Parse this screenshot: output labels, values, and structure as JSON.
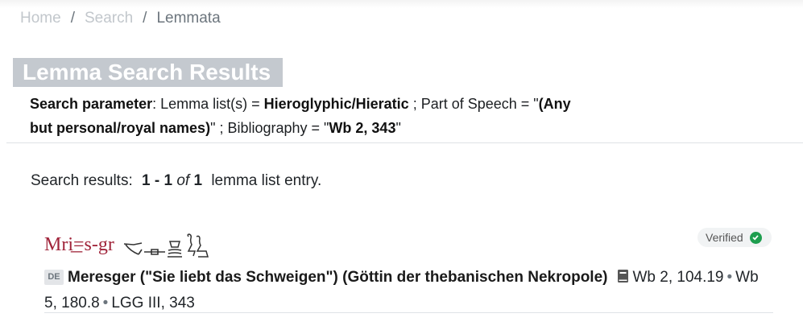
{
  "breadcrumb": {
    "home": "Home",
    "search": "Search",
    "current": "Lemmata",
    "separator": "/"
  },
  "page_title": "Lemma Search Results",
  "search_params": {
    "label": "Search parameter",
    "lemma_list_prefix": ": Lemma list(s) = ",
    "lemma_list_value": "Hieroglyphic/Hieratic",
    "pos_prefix": " ; Part of Speech = \"",
    "pos_value": "(Any but personal/royal names)",
    "bib_prefix": "\" ; Bibliography = \"",
    "bib_value": "Wb 2, 343",
    "suffix": "\""
  },
  "results": {
    "prefix": "Search results:",
    "range": "1 - 1",
    "of": "of",
    "total": "1",
    "suffix": "lemma list entry."
  },
  "entry": {
    "transliteration": "Mri͟=s-gr",
    "status": "Verified",
    "lang_tag": "DE",
    "meaning": "Meresger (\"Sie liebt das Schweigen\") (Göttin der thebanischen Nekropole)",
    "references": [
      "Wb 2, 104.19",
      "Wb 5, 180.8",
      "LGG III, 343"
    ],
    "ref_separator": "•",
    "glyph_icons": [
      "hoe-glyph-icon",
      "bolt-glyph-icon",
      "pot-glyph-icon",
      "seated-goddess-glyph-icon"
    ]
  },
  "colors": {
    "accent_translit": "#a0243a",
    "verified": "#1e9e4f",
    "title_bg": "#c4c9cf"
  }
}
